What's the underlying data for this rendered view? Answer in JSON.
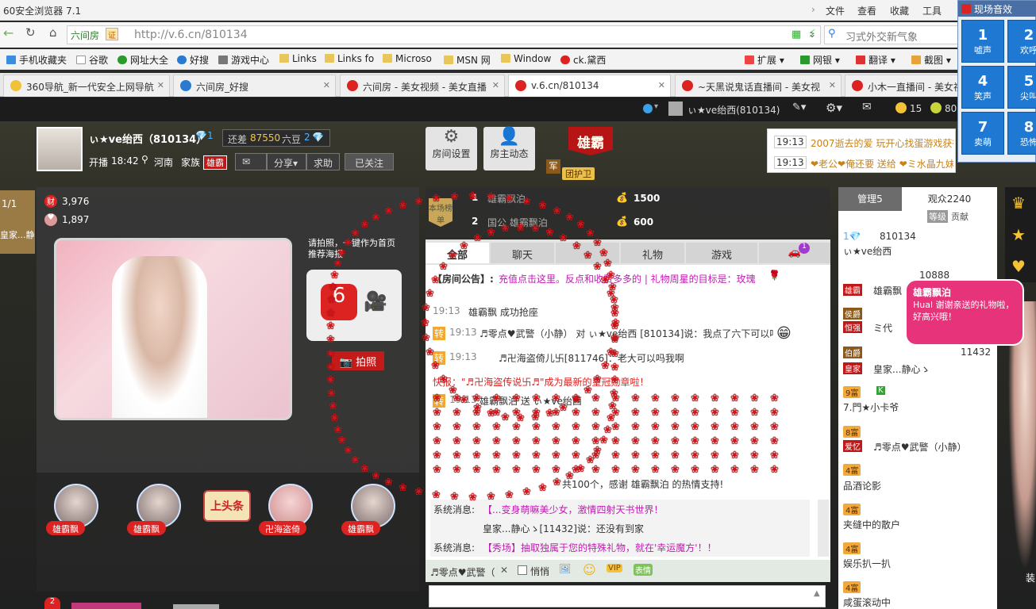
{
  "browser": {
    "title": "60安全浏览器 7.1",
    "menu": [
      "文件",
      "查看",
      "收藏",
      "工具"
    ],
    "address_prefix": "六间房",
    "url": "http://v.6.cn/810134",
    "search_placeholder": "习式外交新气象",
    "bookmarks": [
      "手机收藏夹",
      "谷歌",
      "网址大全",
      "好搜",
      "游戏中心",
      "Links",
      "Links fo",
      "Microso",
      "MSN 网",
      "Window",
      "ck.黛西"
    ],
    "toolbar_right": [
      "扩展",
      "网银",
      "翻译",
      "截图"
    ],
    "tabs": [
      {
        "label": "360导航_新一代安全上网导航"
      },
      {
        "label": "六间房_好搜"
      },
      {
        "label": "六间房 - 美女视频 - 美女直播"
      },
      {
        "label": "v.6.cn/810134"
      },
      {
        "label": "~天黑说鬼话直播间 - 美女视"
      },
      {
        "label": "小木一直播间 - 美女视"
      }
    ]
  },
  "sound_panel": {
    "title": "现场音效",
    "buttons": [
      {
        "num": "1",
        "label": "嘘声"
      },
      {
        "num": "2",
        "label": "欢呼"
      },
      {
        "num": "4",
        "label": "笑声"
      },
      {
        "num": "5",
        "label": "尖叫"
      },
      {
        "num": "7",
        "label": "卖萌"
      },
      {
        "num": "8",
        "label": "恐怖"
      }
    ]
  },
  "top_user_bar": {
    "username": "ぃ★ve绐西(810134)",
    "coins": "15",
    "beans": "80"
  },
  "broadcast": [
    {
      "time": "19:13",
      "text": "2007逝去的爱 玩开心找蛋游戏获得"
    },
    {
      "time": "19:13",
      "text": "❤老公❤俺还要 送给 ❤ミ水晶九妹 10 骑 马 喜"
    }
  ],
  "host": {
    "name": "ぃ★ve绐西（810134）",
    "rank_gap_label": "还差",
    "rank_gap_value": "87550",
    "rank_gap_unit": "六豆",
    "rank_next": "2",
    "start_label": "开播",
    "start_time": "18:42",
    "location": "河南",
    "family_label": "家族",
    "family_name": "雄霸",
    "actions": [
      "分享",
      "求助"
    ],
    "follow": "已关注",
    "wealth": "3,976",
    "fans": "1,897",
    "side_tag": "1/1",
    "side_name": "皇家...静"
  },
  "room_buttons": [
    {
      "label": "房间设置"
    },
    {
      "label": "房主动态"
    }
  ],
  "guard": {
    "title": "雄霸",
    "sub": "团护卫",
    "mark": "军"
  },
  "ranking": {
    "label": "本场榜单",
    "rows": [
      {
        "rank": "1",
        "name": "雄霸飘泊",
        "value": "1500"
      },
      {
        "rank": "2",
        "name": "国公 雄霸飘泊",
        "value": "600"
      }
    ]
  },
  "video": {
    "photo_hint": "请拍照，一键作为首页推荐海报",
    "photo_button": "拍照"
  },
  "chat": {
    "tabs": [
      "全部",
      "聊天",
      "",
      "礼物",
      "游戏"
    ],
    "car_count": "1",
    "notice_label": "【房间公告】:",
    "notice_text": "充值点击这里。反点和收费多多的 | 礼物周星的目标是：玫瑰",
    "lines": [
      {
        "time": "19:13",
        "text": "雄霸飘 成功抢座"
      },
      {
        "time": "19:13",
        "text": "♬零点♥武警（小静） 对 ぃ★ve绐西 [810134]说：我点了六下可以吗姐"
      },
      {
        "time": "19:13",
        "text": "♬卍海盗倚儿卐[811746]：老大可以吗我啊"
      },
      {
        "time": "",
        "text": "快报：\"♬卍海盗传说卐♬\"成为最新的皇冠勋章啦！"
      },
      {
        "time": "19:13",
        "text": "雄霸飘泊 送 ぃ★ve绐西"
      }
    ],
    "thanks": "共100个，感谢 雄霸飘泊 的热情支持!",
    "system": [
      {
        "label": "系统消息:",
        "text": "【...变身萌嘛美少女，激情四射天书世界！"
      },
      {
        "label": "",
        "text": "皇家...静心ゝ[11432]说：还没有到家"
      },
      {
        "label": "系统消息:",
        "text": "【秀场】抽取独属于您的特殊礼物，就在'幸运魔方'！！"
      }
    ],
    "target": "♬零点♥武警（",
    "private_label": "悄悄",
    "input_placeholder": ""
  },
  "audience": {
    "tab_admin": "管理5",
    "tab_viewers": "观众2240",
    "sub_level": "等级",
    "sub_contrib": "贡献",
    "users": [
      {
        "level": "",
        "id": "810134",
        "name": "ぃ★ve绐西"
      },
      {
        "level": "",
        "id": "10888",
        "name": "雄霸飘"
      },
      {
        "level": "",
        "id": "",
        "name": "ミ代"
      },
      {
        "level": "",
        "id": "11432",
        "name": "皇家...静心ゝ"
      },
      {
        "level": "9富",
        "id": "",
        "name": "7.門★小卡爷"
      },
      {
        "level": "8富",
        "id": "",
        "name": "♬零点♥武警（小静）"
      },
      {
        "level": "4富",
        "id": "",
        "name": "品酒论影"
      },
      {
        "level": "4富",
        "id": "",
        "name": "夹缝中的散户"
      },
      {
        "level": "4富",
        "id": "",
        "name": "娱乐扒一扒"
      },
      {
        "level": "4富",
        "id": "",
        "name": "咸蛋滚动中"
      }
    ]
  },
  "speech_bubble": {
    "name": "雄霸飘泊",
    "text": "Hual 谢谢亲送的礼物啦，好高兴哦！"
  },
  "fans_row": [
    {
      "name": "雄霸飘"
    },
    {
      "name": "雄霸飘"
    },
    {
      "name": "卍海盗倚"
    },
    {
      "name": "雄霸飘"
    }
  ],
  "headline_sign": "上头条",
  "bottom_badge": "2",
  "colors": {
    "accent": "#d22222",
    "blue": "#1f78d1",
    "panel": "#3a3a3a"
  }
}
